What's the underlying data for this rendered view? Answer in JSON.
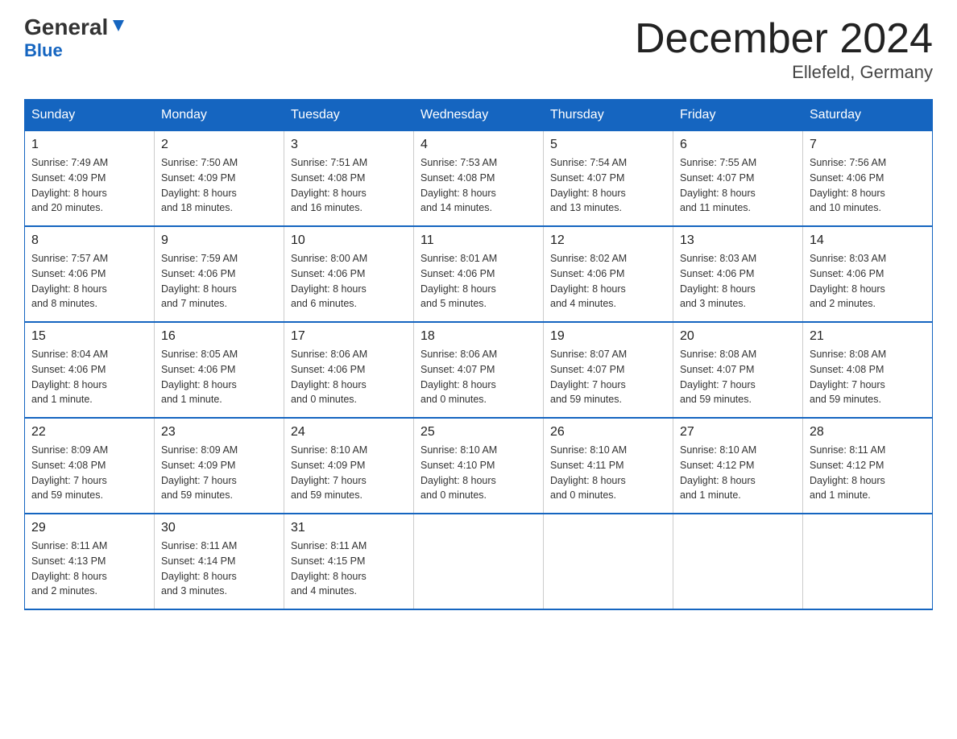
{
  "header": {
    "logo_general": "General",
    "logo_blue": "Blue",
    "month_title": "December 2024",
    "location": "Ellefeld, Germany"
  },
  "days_of_week": [
    "Sunday",
    "Monday",
    "Tuesday",
    "Wednesday",
    "Thursday",
    "Friday",
    "Saturday"
  ],
  "weeks": [
    [
      {
        "day": "1",
        "sunrise": "7:49 AM",
        "sunset": "4:09 PM",
        "daylight": "8 hours and 20 minutes."
      },
      {
        "day": "2",
        "sunrise": "7:50 AM",
        "sunset": "4:09 PM",
        "daylight": "8 hours and 18 minutes."
      },
      {
        "day": "3",
        "sunrise": "7:51 AM",
        "sunset": "4:08 PM",
        "daylight": "8 hours and 16 minutes."
      },
      {
        "day": "4",
        "sunrise": "7:53 AM",
        "sunset": "4:08 PM",
        "daylight": "8 hours and 14 minutes."
      },
      {
        "day": "5",
        "sunrise": "7:54 AM",
        "sunset": "4:07 PM",
        "daylight": "8 hours and 13 minutes."
      },
      {
        "day": "6",
        "sunrise": "7:55 AM",
        "sunset": "4:07 PM",
        "daylight": "8 hours and 11 minutes."
      },
      {
        "day": "7",
        "sunrise": "7:56 AM",
        "sunset": "4:06 PM",
        "daylight": "8 hours and 10 minutes."
      }
    ],
    [
      {
        "day": "8",
        "sunrise": "7:57 AM",
        "sunset": "4:06 PM",
        "daylight": "8 hours and 8 minutes."
      },
      {
        "day": "9",
        "sunrise": "7:59 AM",
        "sunset": "4:06 PM",
        "daylight": "8 hours and 7 minutes."
      },
      {
        "day": "10",
        "sunrise": "8:00 AM",
        "sunset": "4:06 PM",
        "daylight": "8 hours and 6 minutes."
      },
      {
        "day": "11",
        "sunrise": "8:01 AM",
        "sunset": "4:06 PM",
        "daylight": "8 hours and 5 minutes."
      },
      {
        "day": "12",
        "sunrise": "8:02 AM",
        "sunset": "4:06 PM",
        "daylight": "8 hours and 4 minutes."
      },
      {
        "day": "13",
        "sunrise": "8:03 AM",
        "sunset": "4:06 PM",
        "daylight": "8 hours and 3 minutes."
      },
      {
        "day": "14",
        "sunrise": "8:03 AM",
        "sunset": "4:06 PM",
        "daylight": "8 hours and 2 minutes."
      }
    ],
    [
      {
        "day": "15",
        "sunrise": "8:04 AM",
        "sunset": "4:06 PM",
        "daylight": "8 hours and 1 minute."
      },
      {
        "day": "16",
        "sunrise": "8:05 AM",
        "sunset": "4:06 PM",
        "daylight": "8 hours and 1 minute."
      },
      {
        "day": "17",
        "sunrise": "8:06 AM",
        "sunset": "4:06 PM",
        "daylight": "8 hours and 0 minutes."
      },
      {
        "day": "18",
        "sunrise": "8:06 AM",
        "sunset": "4:07 PM",
        "daylight": "8 hours and 0 minutes."
      },
      {
        "day": "19",
        "sunrise": "8:07 AM",
        "sunset": "4:07 PM",
        "daylight": "7 hours and 59 minutes."
      },
      {
        "day": "20",
        "sunrise": "8:08 AM",
        "sunset": "4:07 PM",
        "daylight": "7 hours and 59 minutes."
      },
      {
        "day": "21",
        "sunrise": "8:08 AM",
        "sunset": "4:08 PM",
        "daylight": "7 hours and 59 minutes."
      }
    ],
    [
      {
        "day": "22",
        "sunrise": "8:09 AM",
        "sunset": "4:08 PM",
        "daylight": "7 hours and 59 minutes."
      },
      {
        "day": "23",
        "sunrise": "8:09 AM",
        "sunset": "4:09 PM",
        "daylight": "7 hours and 59 minutes."
      },
      {
        "day": "24",
        "sunrise": "8:10 AM",
        "sunset": "4:09 PM",
        "daylight": "7 hours and 59 minutes."
      },
      {
        "day": "25",
        "sunrise": "8:10 AM",
        "sunset": "4:10 PM",
        "daylight": "8 hours and 0 minutes."
      },
      {
        "day": "26",
        "sunrise": "8:10 AM",
        "sunset": "4:11 PM",
        "daylight": "8 hours and 0 minutes."
      },
      {
        "day": "27",
        "sunrise": "8:10 AM",
        "sunset": "4:12 PM",
        "daylight": "8 hours and 1 minute."
      },
      {
        "day": "28",
        "sunrise": "8:11 AM",
        "sunset": "4:12 PM",
        "daylight": "8 hours and 1 minute."
      }
    ],
    [
      {
        "day": "29",
        "sunrise": "8:11 AM",
        "sunset": "4:13 PM",
        "daylight": "8 hours and 2 minutes."
      },
      {
        "day": "30",
        "sunrise": "8:11 AM",
        "sunset": "4:14 PM",
        "daylight": "8 hours and 3 minutes."
      },
      {
        "day": "31",
        "sunrise": "8:11 AM",
        "sunset": "4:15 PM",
        "daylight": "8 hours and 4 minutes."
      },
      {
        "day": "",
        "sunrise": "",
        "sunset": "",
        "daylight": ""
      },
      {
        "day": "",
        "sunrise": "",
        "sunset": "",
        "daylight": ""
      },
      {
        "day": "",
        "sunrise": "",
        "sunset": "",
        "daylight": ""
      },
      {
        "day": "",
        "sunrise": "",
        "sunset": "",
        "daylight": ""
      }
    ]
  ]
}
